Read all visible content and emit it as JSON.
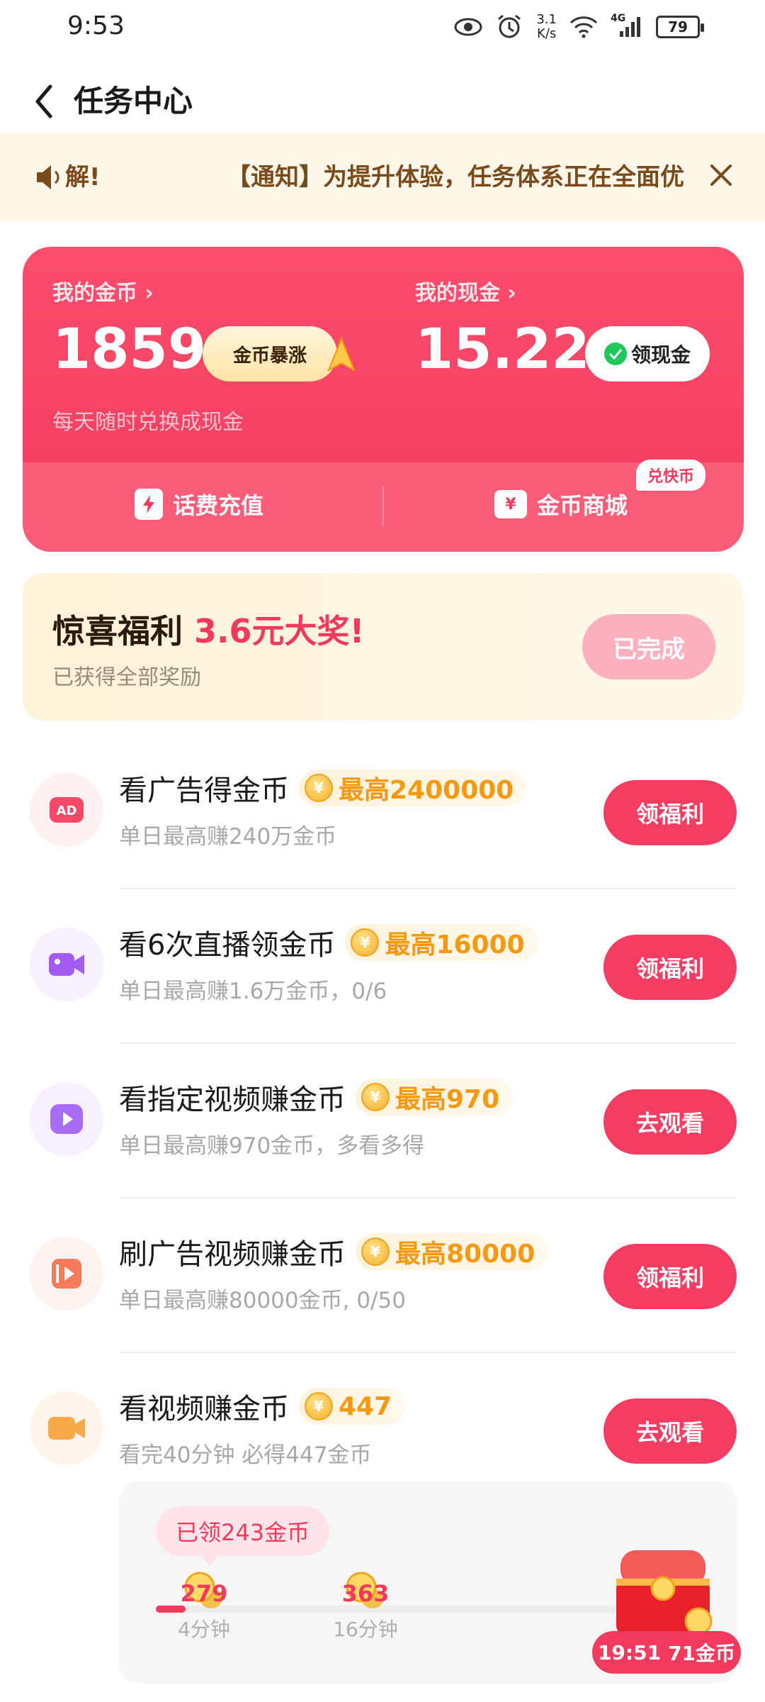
{
  "status_bar": {
    "time": "9:53",
    "net_speed_value": "3.1",
    "net_speed_unit": "K/s",
    "signal_label": "4G",
    "battery": "79",
    "icons": [
      "eye-icon",
      "alarm-icon",
      "wifi-icon",
      "signal-icon",
      "battery-icon"
    ]
  },
  "header": {
    "title": "任务中心"
  },
  "notice": {
    "short_text": "解!",
    "text": "【通知】为提升体验，任务体系正在全面优"
  },
  "wallet": {
    "coins_label": "我的金币 ›",
    "coins_value": "1859",
    "coin_boost_label": "金币暴涨",
    "cash_label": "我的现金 ›",
    "cash_value": "15.22",
    "cash_button_label": "领现金",
    "hint": "每天随时兑换成现金",
    "link_recharge": "话费充值",
    "link_mall": "金币商城",
    "mall_badge": "兑快币"
  },
  "surprise": {
    "title": "惊喜福利",
    "amount": "3.6元大奖!",
    "subtitle": "已获得全部奖励",
    "button_label": "已完成"
  },
  "tasks": [
    {
      "title": "看广告得金币",
      "reward": "最高2400000",
      "subtitle": "单日最高赚240万金币",
      "button": "领福利",
      "icon": "ad-icon",
      "icon_color": "#f54a6a",
      "icon_bg": "#fff0f2"
    },
    {
      "title": "看6次直播领金币",
      "reward": "最高16000",
      "subtitle": "单日最高赚1.6万金币，0/6",
      "button": "领福利",
      "icon": "video-camera-icon",
      "icon_color": "#a45cf0",
      "icon_bg": "#f6f0ff"
    },
    {
      "title": "看指定视频赚金币",
      "reward": "最高970",
      "subtitle": "单日最高赚970金币，多看多得",
      "button": "去观看",
      "icon": "play-icon",
      "icon_color": "#a86cf4",
      "icon_bg": "#f6f0ff"
    },
    {
      "title": "刷广告视频赚金币",
      "reward": "最高80000",
      "subtitle": "单日最高赚80000金币, 0/50",
      "button": "领福利",
      "icon": "video-ad-icon",
      "icon_color": "#f77a5a",
      "icon_bg": "#fff3ef"
    },
    {
      "title": "看视频赚金币",
      "reward": "447",
      "subtitle": "看完40分钟 必得447金币",
      "button": "去观看",
      "icon": "video-icon",
      "icon_color": "#f9a84a",
      "icon_bg": "#fff5ea"
    }
  ],
  "progress": {
    "claimed_label": "已领243金币",
    "fill_fraction": 0.055,
    "milestones": [
      {
        "amount": "279",
        "time": "4分钟"
      },
      {
        "amount": "363",
        "time": "16分钟"
      }
    ],
    "chest_timer": "19:51",
    "chest_reward": "71金币"
  },
  "colors": {
    "brand_red": "#f33a5c",
    "reward_orange": "#f59a10",
    "notice_bg": "#fff8ea"
  }
}
